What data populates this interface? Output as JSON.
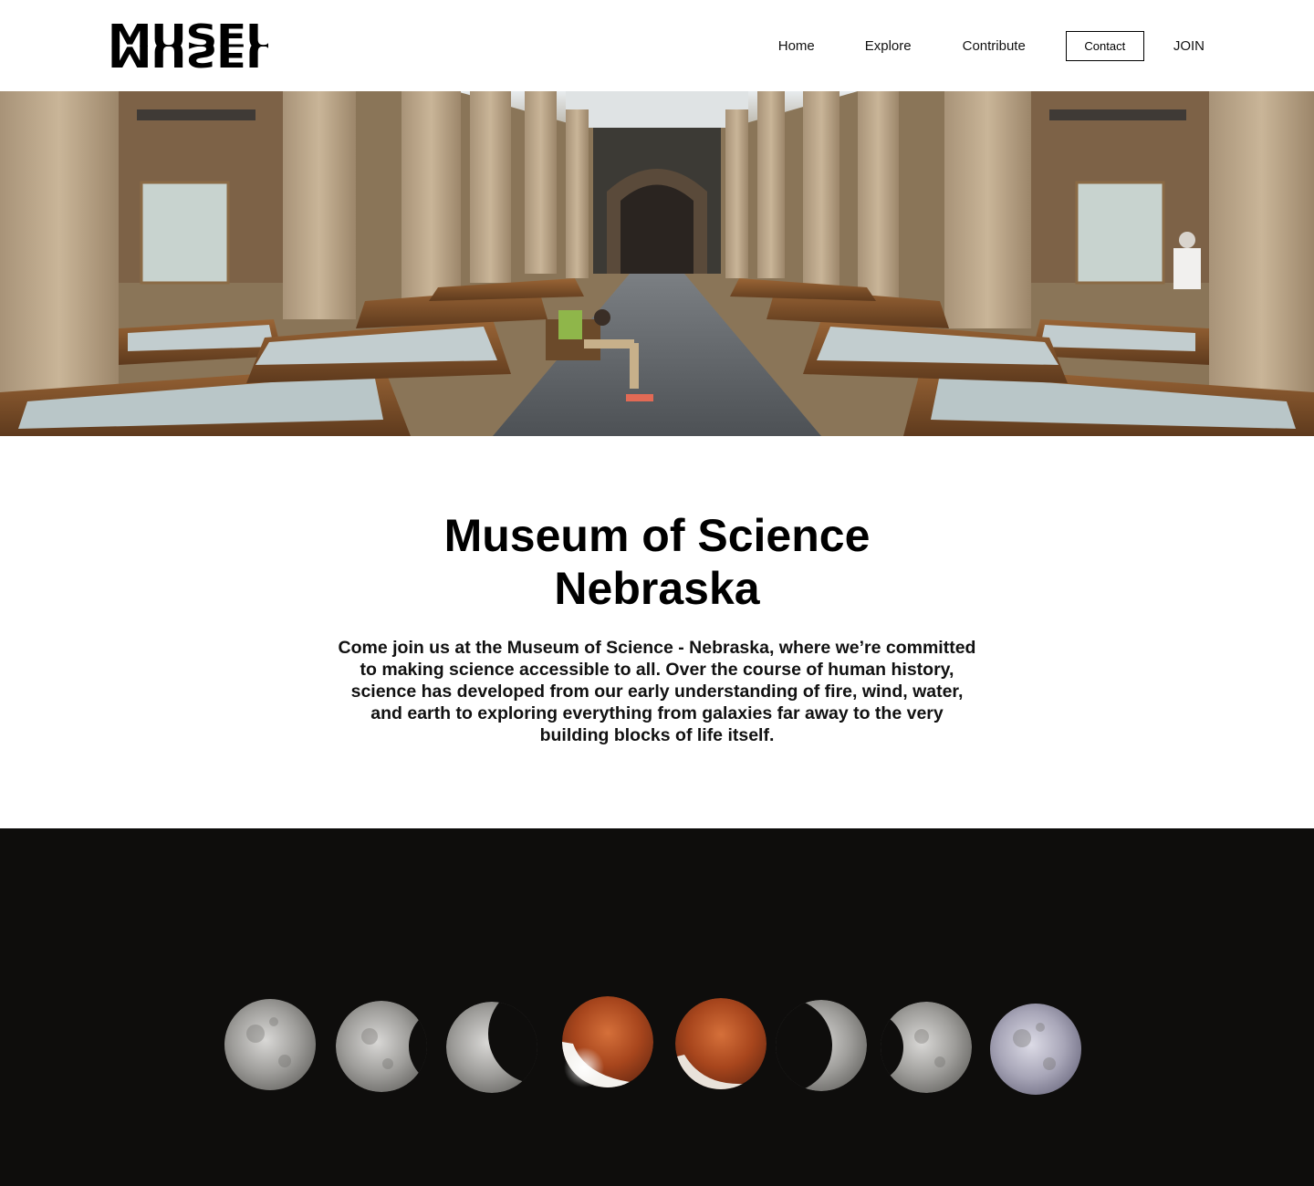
{
  "header": {
    "logo_text": "MUSEUM",
    "nav": {
      "home": "Home",
      "explore": "Explore",
      "contribute": "Contribute",
      "contact": "Contact",
      "join": "JOIN"
    }
  },
  "intro": {
    "title_line1": "Museum of Science",
    "title_line2": "Nebraska",
    "description": "Come join us at the Museum of Science - Nebraska, where we’re committed to making science accessible to all. Over the course of human history, science has developed from our early understanding of fire, wind, water, and earth to exploring everything from galaxies far away to the very building blocks of life itself."
  },
  "images": {
    "hero": "museum-hall-photo",
    "eclipse": "lunar-eclipse-phases-photo"
  },
  "colors": {
    "text": "#111111",
    "background": "#ffffff",
    "eclipse_background": "#0e0d0c",
    "blood_moon": "#b84a22"
  }
}
